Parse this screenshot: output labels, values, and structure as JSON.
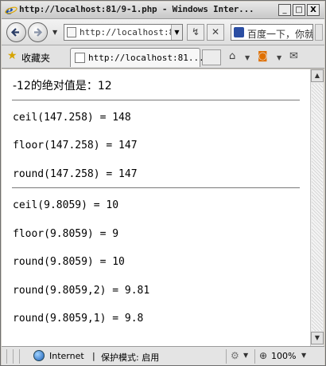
{
  "window": {
    "title": "http://localhost:81/9-1.php - Windows Inter...",
    "buttons": {
      "minimize": "_",
      "maximize": "□",
      "close": "X"
    }
  },
  "toolbar": {
    "address": "http://localhost:8",
    "search_text": "百度一下，你就"
  },
  "favorites": {
    "label": "收藏夹",
    "tab_title": "http://localhost:81..."
  },
  "content": {
    "lines_group1": [
      "-12的绝对值是：12"
    ],
    "lines_group2": [
      "ceil(147.258) = 148",
      "floor(147.258) = 147",
      "round(147.258) = 147"
    ],
    "lines_group3": [
      "ceil(9.8059) = 10",
      "floor(9.8059) = 9",
      "round(9.8059) = 10",
      "round(9.8059,2) = 9.81",
      "round(9.8059,1) = 9.8"
    ]
  },
  "status": {
    "zone": "Internet",
    "separator": "|",
    "protected_mode": "保护模式: 启用",
    "zoom": "100%"
  }
}
